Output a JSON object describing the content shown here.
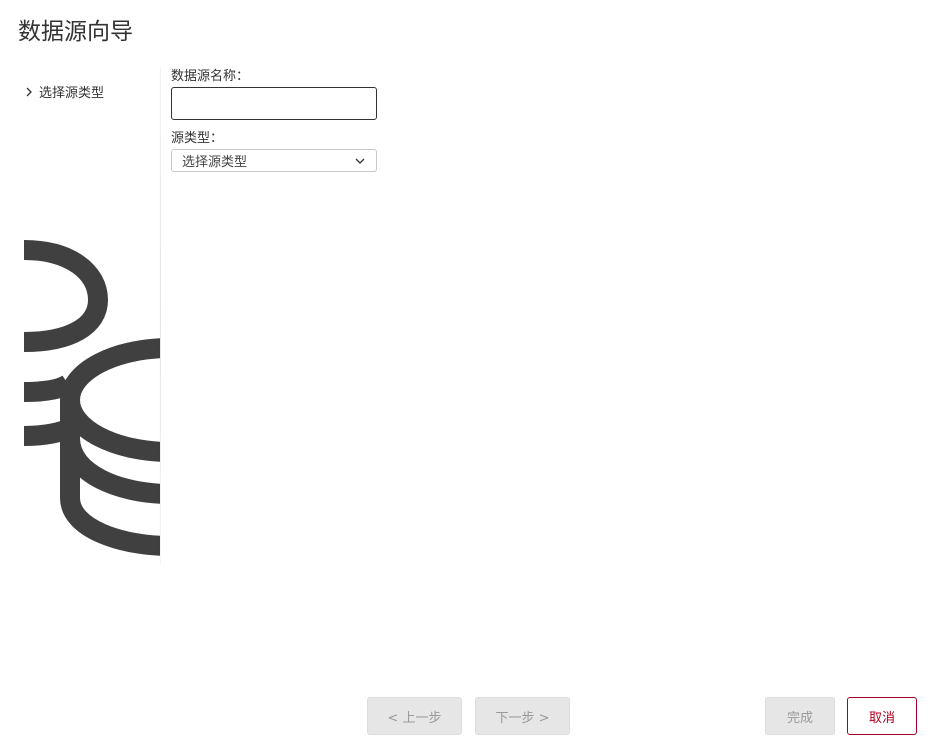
{
  "window": {
    "title": "数据源向导"
  },
  "steps": {
    "items": [
      {
        "label": "选择源类型",
        "icon": "chevron-right-icon"
      }
    ]
  },
  "illustration": {
    "icon": "database-icon",
    "color": "#404040"
  },
  "form": {
    "name_label": "数据源名称：",
    "name_value": "",
    "type_label": "源类型：",
    "type_selected": "选择源类型",
    "type_dropdown_icon": "chevron-down-icon"
  },
  "footer": {
    "prev_label": "< 上一步",
    "next_label": "下一步 >",
    "finish_label": "完成",
    "cancel_label": "取消",
    "cancel_color": "#a5002a"
  }
}
